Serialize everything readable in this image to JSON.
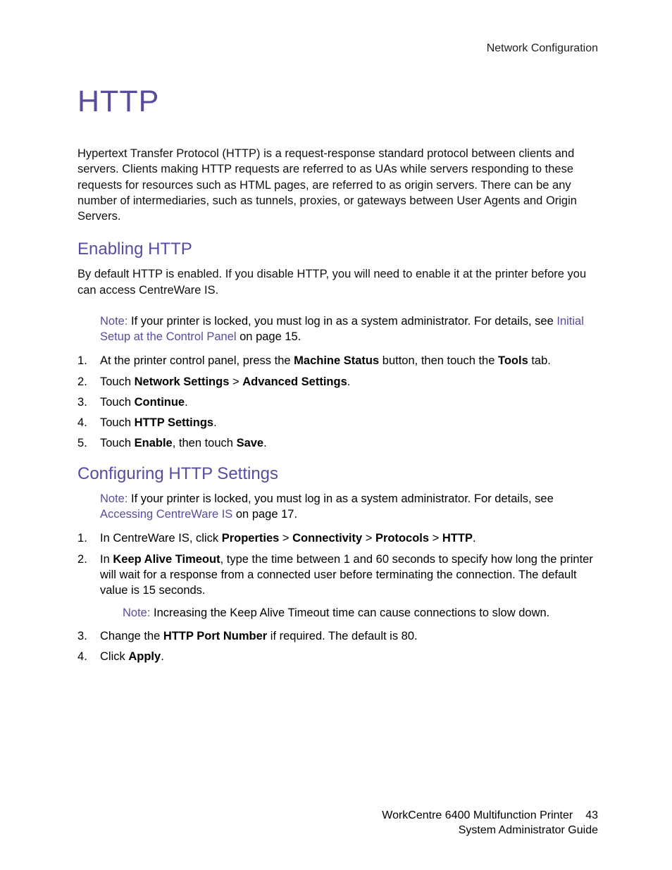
{
  "header": {
    "section": "Network Configuration"
  },
  "title": "HTTP",
  "intro": "Hypertext Transfer Protocol (HTTP) is a request-response standard protocol between clients and servers. Clients making HTTP requests are referred to as UAs while servers responding to these requests for resources such as HTML pages, are referred to as origin servers. There can be any number of intermediaries, such as tunnels, proxies, or gateways between User Agents and Origin Servers.",
  "section1": {
    "heading": "Enabling HTTP",
    "para": "By default HTTP is enabled. If you disable HTTP, you will need to enable it at the printer before you can access CentreWare IS.",
    "note": {
      "label": "Note:",
      "pre": " If your printer is locked, you must log in as a system administrator. For details, see ",
      "link": "Initial Setup at the Control Panel",
      "post": " on page 15."
    },
    "steps": {
      "s1a": "At the printer control panel, press the ",
      "s1b": "Machine Status",
      "s1c": " button, then touch the ",
      "s1d": "Tools",
      "s1e": " tab.",
      "s2a": "Touch ",
      "s2b": "Network Settings",
      "s2c": " > ",
      "s2d": "Advanced Settings",
      "s2e": ".",
      "s3a": "Touch ",
      "s3b": "Continue",
      "s3c": ".",
      "s4a": "Touch ",
      "s4b": "HTTP Settings",
      "s4c": ".",
      "s5a": "Touch ",
      "s5b": "Enable",
      "s5c": ", then touch ",
      "s5d": "Save",
      "s5e": "."
    }
  },
  "section2": {
    "heading": "Configuring HTTP Settings",
    "note": {
      "label": "Note:",
      "pre": " If your printer is locked, you must log in as a system administrator. For details, see ",
      "link": "Accessing CentreWare IS",
      "post": " on page 17."
    },
    "steps": {
      "s1a": "In CentreWare IS, click ",
      "s1b": "Properties",
      "s1c": " > ",
      "s1d": "Connectivity",
      "s1e": " > ",
      "s1f": "Protocols",
      "s1g": " > ",
      "s1h": "HTTP",
      "s1i": ".",
      "s2a": "In ",
      "s2b": "Keep Alive Timeout",
      "s2c": ", type the time between 1 and 60 seconds to specify how long the printer will wait for a response from a connected user before terminating the connection. The default value is 15 seconds.",
      "s2note_label": "Note:",
      "s2note_text": " Increasing the Keep Alive Timeout time can cause connections to slow down.",
      "s3a": "Change the ",
      "s3b": "HTTP Port Number",
      "s3c": " if required. The default is 80.",
      "s4a": "Click ",
      "s4b": "Apply",
      "s4c": "."
    }
  },
  "footer": {
    "product": "WorkCentre 6400 Multifunction Printer",
    "guide": "System Administrator Guide",
    "page": "43"
  }
}
